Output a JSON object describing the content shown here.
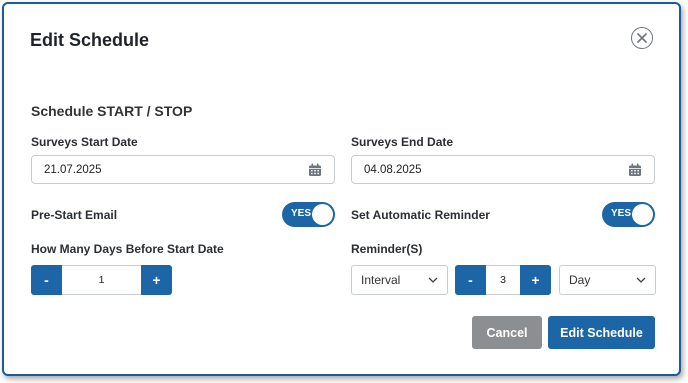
{
  "dialog": {
    "title": "Edit Schedule"
  },
  "section": {
    "title": "Schedule START / STOP"
  },
  "start_date": {
    "label": "Surveys Start Date",
    "value": "21.07.2025"
  },
  "end_date": {
    "label": "Surveys End Date",
    "value": "04.08.2025"
  },
  "pre_start_email": {
    "label": "Pre-Start Email",
    "toggle_text": "YES"
  },
  "auto_reminder": {
    "label": "Set Automatic Reminder",
    "toggle_text": "YES"
  },
  "days_before": {
    "label": "How Many Days Before Start Date",
    "value": "1",
    "minus": "-",
    "plus": "+"
  },
  "reminders": {
    "label": "Reminder(S)",
    "type_value": "Interval",
    "count": "3",
    "minus": "-",
    "plus": "+",
    "unit_value": "Day"
  },
  "buttons": {
    "cancel": "Cancel",
    "submit": "Edit Schedule"
  },
  "colors": {
    "primary": "#1c65a6",
    "cancel": "#8c8f92",
    "border": "#1c5c97"
  }
}
